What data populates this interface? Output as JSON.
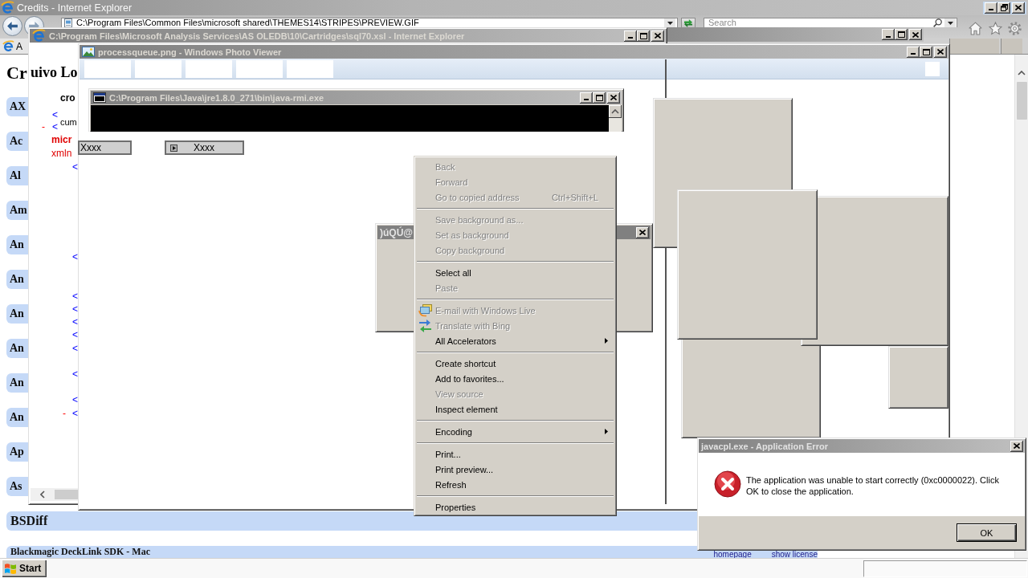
{
  "browser": {
    "title": "Credits - Internet Explorer",
    "address": "C:\\Program Files\\Common Files\\microsoft shared\\THEMES14\\STRIPES\\PREVIEW.GIF",
    "search": {
      "placeholder": "Search"
    },
    "tab": {
      "label": "A"
    },
    "page": {
      "heading": "Cr",
      "categories": [
        "AX",
        "Ac",
        "Al",
        "Am",
        "An",
        "An",
        "An",
        "An",
        "An",
        "An",
        "Ap",
        "As"
      ],
      "rows": [
        {
          "label": "BSDiff"
        },
        {
          "label": "Blackmagic DeckLink SDK - Mac",
          "links": [
            "homepage",
            "show license"
          ]
        }
      ]
    }
  },
  "xml_window": {
    "title": "C:\\Program Files\\Microsoft Analysis Services\\AS OLEDB\\10\\Cartridges\\sql70.xsl - Internet Explorer",
    "heading": "uivo Lo",
    "fragments": [
      {
        "text": "cro",
        "kind": "name"
      },
      {
        "text": "<",
        "kind": "bracket"
      },
      {
        "text": "cum",
        "kind": "text"
      },
      {
        "text": "-",
        "kind": "toggle"
      },
      {
        "text": "<",
        "kind": "bracket"
      },
      {
        "text": "micr",
        "kind": "tag"
      },
      {
        "text": "xmln",
        "kind": "attribute"
      },
      {
        "text": "<",
        "kind": "bracket"
      },
      {
        "text": "<",
        "kind": "bracket"
      },
      {
        "text": "<",
        "kind": "bracket"
      },
      {
        "text": "<",
        "kind": "bracket"
      },
      {
        "text": "<",
        "kind": "bracket"
      },
      {
        "text": "<",
        "kind": "bracket"
      },
      {
        "text": "<",
        "kind": "bracket"
      },
      {
        "text": "<",
        "kind": "bracket"
      },
      {
        "text": "<",
        "kind": "bracket"
      },
      {
        "text": "-",
        "kind": "toggle"
      },
      {
        "text": "<",
        "kind": "bracket"
      }
    ]
  },
  "photo_viewer": {
    "title": "processqueue.png - Windows Photo Viewer"
  },
  "console": {
    "title": "C:\\Program Files\\Java\\jre1.8.0_271\\bin\\java-rmi.exe"
  },
  "floating_buttons": [
    {
      "label": "Xxxx",
      "kind": "plain"
    },
    {
      "label": "Xxxx",
      "kind": "icon"
    }
  ],
  "garbled_dialog": {
    "title": ")úQÚ@"
  },
  "context_menu": {
    "groups": [
      [
        {
          "label": "Back",
          "kind": "plain",
          "disabled": true
        },
        {
          "label": "Forward",
          "kind": "plain",
          "disabled": true
        },
        {
          "label": "Go to copied address",
          "kind": "plain",
          "shortcut": "Ctrl+Shift+L",
          "disabled": true
        }
      ],
      [
        {
          "label": "Save background as...",
          "kind": "plain",
          "disabled": true
        },
        {
          "label": "Set as background",
          "kind": "plain",
          "disabled": true
        },
        {
          "label": "Copy background",
          "kind": "plain",
          "disabled": true
        }
      ],
      [
        {
          "label": "Select all",
          "kind": "plain",
          "disabled": false
        },
        {
          "label": "Paste",
          "kind": "plain",
          "disabled": true
        }
      ],
      [
        {
          "label": "E-mail with Windows Live",
          "kind": "mail",
          "disabled": true
        },
        {
          "label": "Translate with Bing",
          "kind": "translate",
          "disabled": true
        },
        {
          "label": "All Accelerators",
          "kind": "submenu",
          "disabled": false
        }
      ],
      [
        {
          "label": "Create shortcut",
          "kind": "plain",
          "disabled": false
        },
        {
          "label": "Add to favorites...",
          "kind": "plain",
          "disabled": false
        },
        {
          "label": "View source",
          "kind": "plain",
          "disabled": true
        },
        {
          "label": "Inspect element",
          "kind": "plain",
          "disabled": false
        }
      ],
      [
        {
          "label": "Encoding",
          "kind": "submenu",
          "disabled": false
        }
      ],
      [
        {
          "label": "Print...",
          "kind": "plain",
          "disabled": false
        },
        {
          "label": "Print preview...",
          "kind": "plain",
          "disabled": false
        },
        {
          "label": "Refresh",
          "kind": "plain",
          "disabled": false
        }
      ],
      [
        {
          "label": "Properties",
          "kind": "plain",
          "disabled": false
        }
      ]
    ]
  },
  "error_dialog": {
    "title": "javacpl.exe - Application Error",
    "message": "The application was unable to start correctly (0xc0000022). Click OK to close the application.",
    "button": "OK"
  },
  "taskbar": {
    "start": "Start"
  }
}
